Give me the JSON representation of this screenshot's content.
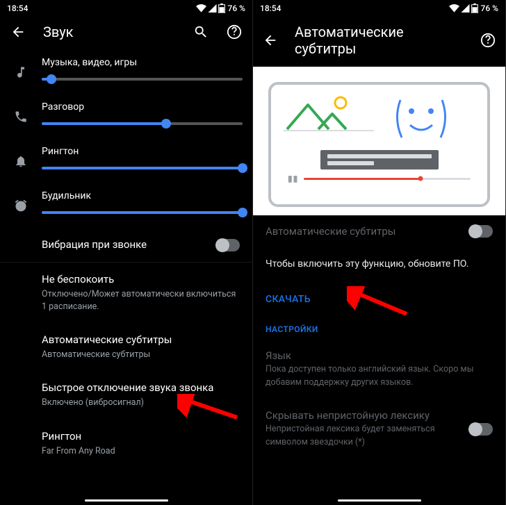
{
  "status": {
    "time": "18:54",
    "battery": "76 %"
  },
  "left": {
    "title": "Звук",
    "sliders": {
      "media": {
        "label": "Музыка, видео, игры",
        "value": 5
      },
      "call": {
        "label": "Разговор",
        "value": 62
      },
      "ring": {
        "label": "Рингтон",
        "value": 100
      },
      "alarm": {
        "label": "Будильник",
        "value": 100
      }
    },
    "vibrate": {
      "label": "Вибрация при звонке",
      "on": false
    },
    "items": {
      "dnd": {
        "title": "Не беспокоить",
        "sub": "Отключено/Может автоматически включиться 1 расписание."
      },
      "captions": {
        "title": "Автоматические субтитры",
        "sub": "Автоматические субтитры"
      },
      "shortcut": {
        "title": "Быстрое отключение звука звонка",
        "sub": "Включено (вибросигнал)"
      },
      "ringtone": {
        "title": "Рингтон",
        "sub": "Far From Any Road"
      }
    }
  },
  "right": {
    "title": "Автоматические субтитры",
    "toggle": {
      "label": "Автоматические субтитры",
      "on": false
    },
    "note": "Чтобы включить эту функцию, обновите ПО.",
    "download": "СКАЧАТЬ",
    "section": "НАСТРОЙКИ",
    "language": {
      "title": "Язык",
      "sub": "Пока доступен только английский язык. Скоро мы добавим поддержку других языков."
    },
    "profanity": {
      "title": "Скрывать непристойную лексику",
      "sub": "Непристойная лексика будет заменяться символом звездочки (*)",
      "on": false
    }
  }
}
